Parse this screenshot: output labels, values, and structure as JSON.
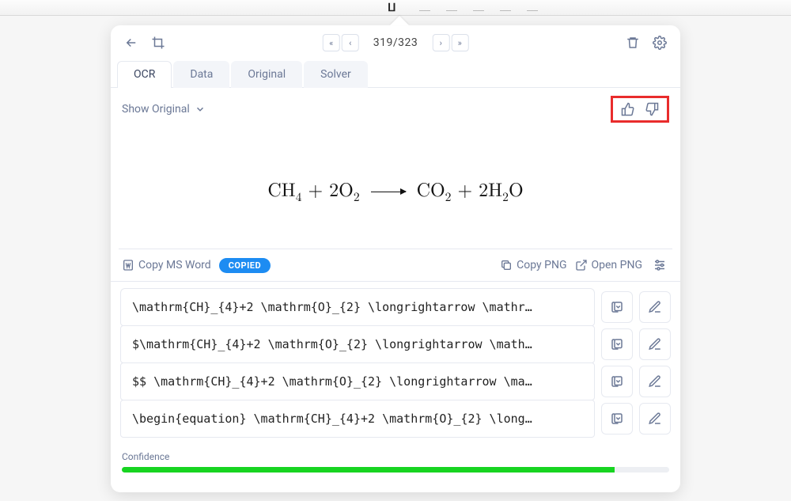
{
  "menubar": {
    "logo_glyph": "ⵡ"
  },
  "topbar": {
    "page_current": 319,
    "page_total": 323
  },
  "tabs": {
    "ocr": "OCR",
    "data": "Data",
    "original": "Original",
    "solver": "Solver",
    "active": "ocr"
  },
  "toolbar": {
    "show_original": "Show Original"
  },
  "equation": {
    "lhs1": "CH",
    "lhs1_sub": "4",
    "plus": " + ",
    "lhs2_coef": "2O",
    "lhs2_sub": "2",
    "rhs1": "CO",
    "rhs1_sub": "2",
    "rhs2_coef": "2H",
    "rhs2_sub": "2",
    "rhs2_suffix": "O"
  },
  "actions": {
    "copy_word": "Copy MS Word",
    "copied_badge": "COPIED",
    "copy_png": "Copy PNG",
    "open_png": "Open PNG"
  },
  "code_rows": [
    "\\mathrm{CH}_{4}+2 \\mathrm{O}_{2} \\longrightarrow \\mathr…",
    "$\\mathrm{CH}_{4}+2 \\mathrm{O}_{2} \\longrightarrow \\math…",
    "$$ \\mathrm{CH}_{4}+2 \\mathrm{O}_{2} \\longrightarrow \\ma…",
    "\\begin{equation} \\mathrm{CH}_{4}+2 \\mathrm{O}_{2} \\long…"
  ],
  "confidence": {
    "label": "Confidence",
    "percent": 90
  }
}
